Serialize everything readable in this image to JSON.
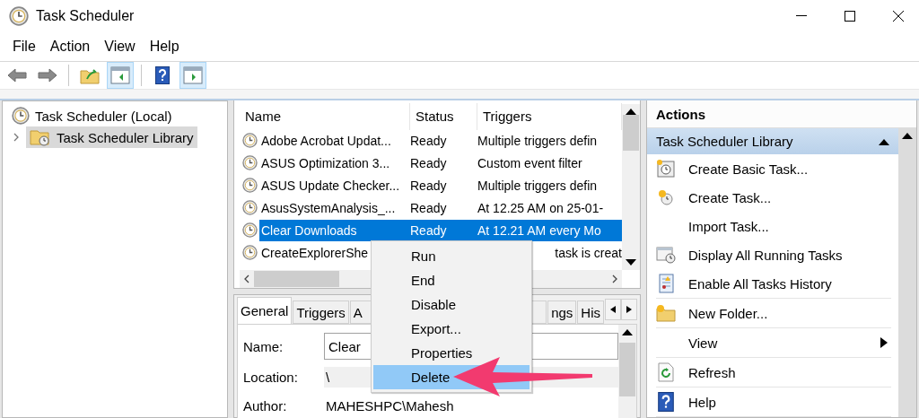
{
  "window": {
    "title": "Task Scheduler"
  },
  "menu": [
    "File",
    "Action",
    "View",
    "Help"
  ],
  "toolbar": [
    {
      "kind": "back",
      "on": false
    },
    {
      "kind": "forward",
      "on": false
    },
    {
      "kind": "separator"
    },
    {
      "kind": "up",
      "on": false
    },
    {
      "kind": "console-tree",
      "on": true
    },
    {
      "kind": "separator"
    },
    {
      "kind": "help",
      "on": false
    },
    {
      "kind": "action-pane",
      "on": true
    }
  ],
  "tree": {
    "label": "Task Scheduler (Local)",
    "expanded": true,
    "selected": false,
    "children": [
      {
        "label": "Task Scheduler Library",
        "expanded": false,
        "selected": true
      }
    ]
  },
  "table": {
    "columns": [
      "Name",
      "Status",
      "Triggers"
    ],
    "rows": [
      {
        "name": "Adobe Acrobat Updat...",
        "status": "Ready",
        "triggers": "Multiple triggers defin",
        "selected": false,
        "covered": false
      },
      {
        "name": "ASUS Optimization 3...",
        "status": "Ready",
        "triggers": "Custom event filter",
        "selected": false,
        "covered": false
      },
      {
        "name": "ASUS Update Checker...",
        "status": "Ready",
        "triggers": "Multiple triggers defin",
        "selected": false,
        "covered": false
      },
      {
        "name": "AsusSystemAnalysis_...",
        "status": "Ready",
        "triggers": "At 12.25 AM on 25-01-",
        "selected": false,
        "covered": false
      },
      {
        "name": "Clear Downloads",
        "status": "Ready",
        "triggers": "At 12.21 AM every Mo",
        "selected": true,
        "covered": false
      },
      {
        "name": "CreateExplorerShe",
        "triggers": "task is creat",
        "selected": false,
        "covered": true
      }
    ]
  },
  "detail": {
    "tabs": [
      {
        "label": "General",
        "selected": true,
        "covered": false
      },
      {
        "label": "Triggers",
        "selected": false,
        "covered": false
      },
      {
        "label": "A",
        "selected": false,
        "covered": true
      },
      {
        "label": "ngs",
        "selected": false,
        "covered": false
      },
      {
        "label": "His",
        "selected": false,
        "covered": false
      }
    ],
    "fields": [
      {
        "label": "Name:",
        "value": "Clear",
        "kind": "input"
      },
      {
        "label": "Location:",
        "value": "\\",
        "kind": "shaded"
      },
      {
        "label": "Author:",
        "value": "MAHESHPC\\Mahesh",
        "kind": "plain"
      }
    ]
  },
  "context_menu": {
    "items": [
      {
        "label": "Run",
        "selected": false
      },
      {
        "label": "End",
        "selected": false
      },
      {
        "label": "Disable",
        "selected": false
      },
      {
        "label": "Export...",
        "selected": false
      },
      {
        "label": "Properties",
        "selected": false
      },
      {
        "label": "Delete",
        "selected": true
      }
    ]
  },
  "actions": {
    "title": "Actions",
    "section": {
      "label": "Task Scheduler Library",
      "expanded": true
    },
    "groups": [
      [
        {
          "label": "Create Basic Task...",
          "kind": "action"
        },
        {
          "label": "Create Task...",
          "kind": "action"
        },
        {
          "label": "Import Task...",
          "kind": "action"
        },
        {
          "label": "Display All Running Tasks",
          "kind": "action"
        },
        {
          "label": "Enable All Tasks History",
          "kind": "action"
        }
      ],
      [
        {
          "label": "New Folder...",
          "kind": "action"
        }
      ],
      [
        {
          "label": "View",
          "kind": "submenu"
        }
      ],
      [
        {
          "label": "Refresh",
          "kind": "action"
        }
      ],
      [
        {
          "label": "Help",
          "kind": "action"
        }
      ]
    ]
  }
}
